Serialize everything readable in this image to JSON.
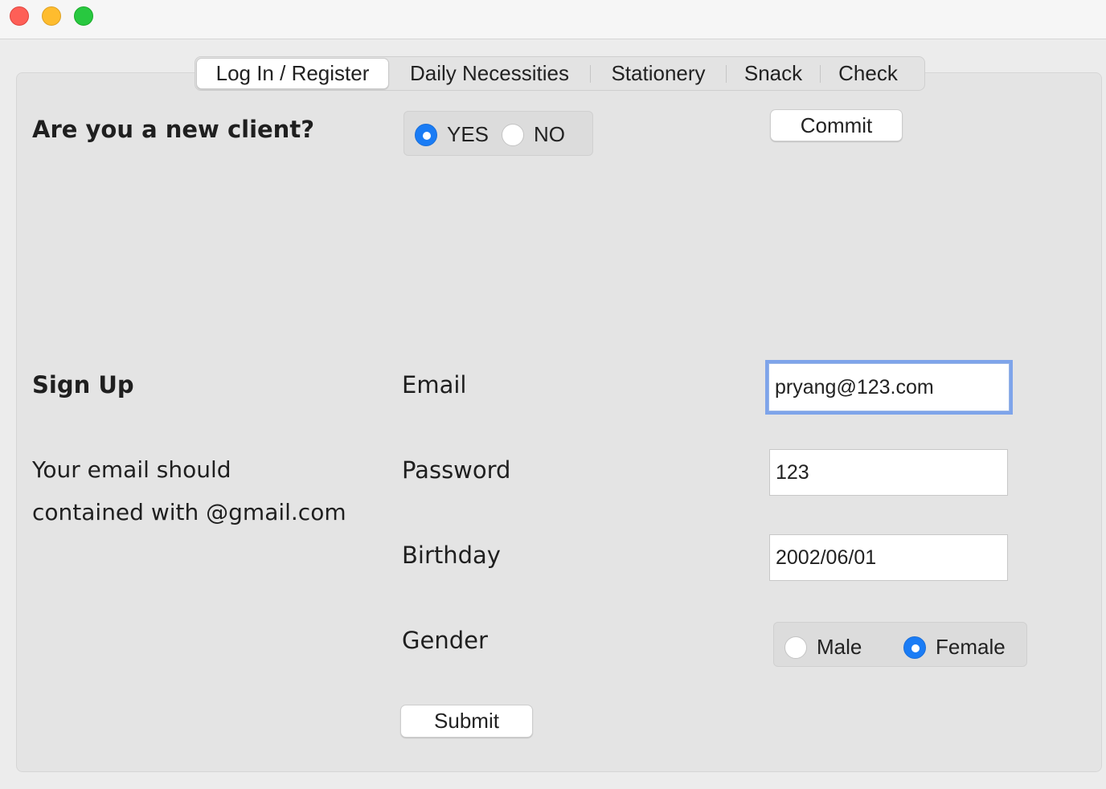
{
  "tabs": [
    {
      "label": "Log In / Register",
      "active": true
    },
    {
      "label": "Daily Necessities",
      "active": false
    },
    {
      "label": "Stationery",
      "active": false
    },
    {
      "label": "Snack",
      "active": false
    },
    {
      "label": "Check",
      "active": false
    }
  ],
  "login": {
    "question": "Are you a new client?",
    "options": [
      {
        "label": "YES",
        "selected": true
      },
      {
        "label": "NO",
        "selected": false
      }
    ],
    "commit_label": "Commit"
  },
  "signup": {
    "heading": "Sign Up",
    "hint_line1": "Your email should",
    "hint_line2": "contained with @gmail.com",
    "email_label": "Email",
    "email_value": "pryang@123.com",
    "password_label": "Password",
    "password_value": "123",
    "birthday_label": "Birthday",
    "birthday_value": "2002/06/01",
    "gender_label": "Gender",
    "gender_options": [
      {
        "label": "Male",
        "selected": false
      },
      {
        "label": "Female",
        "selected": true
      }
    ],
    "submit_label": "Submit"
  },
  "colors": {
    "accent": "#1a7cf5",
    "focus_ring": "#7ea4ea",
    "panel_bg": "#e4e4e4"
  }
}
